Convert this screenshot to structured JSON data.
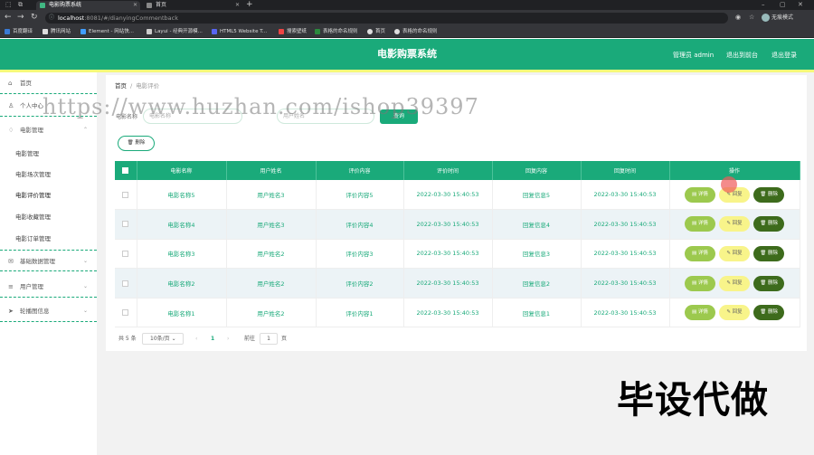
{
  "browser": {
    "tabs": [
      {
        "label": "电影购票系统",
        "active": true
      },
      {
        "label": "首页",
        "active": false
      }
    ],
    "url_host": "localhost",
    "url_path": ":8081/#/dianyingCommentback",
    "profile_label": "无痕模式",
    "bookmarks": [
      "百度翻译",
      "腾讯网站",
      "Element - 网站快...",
      "Layui - 经典开源模...",
      "HTML5 Website T...",
      "搜索壁纸",
      "表格的命名规则",
      "首页",
      "表格的命名规则"
    ]
  },
  "app": {
    "title": "电影购票系统",
    "user_label": "管理员 admin",
    "back_link": "退出到前台",
    "logout_link": "退出登录"
  },
  "sidebar": {
    "items": [
      {
        "label": "首页",
        "icon": "home-icon",
        "type": "top"
      },
      {
        "label": "个人中心",
        "icon": "user-icon",
        "type": "group"
      },
      {
        "label": "电影管理",
        "icon": "bulb-icon",
        "type": "group-open"
      },
      {
        "label": "电影管理",
        "type": "sub"
      },
      {
        "label": "电影场次管理",
        "type": "sub"
      },
      {
        "label": "电影评价管理",
        "type": "sub-active"
      },
      {
        "label": "电影收藏管理",
        "type": "sub"
      },
      {
        "label": "电影订单管理",
        "type": "sub"
      },
      {
        "label": "基础数据管理",
        "icon": "mail-icon",
        "type": "group"
      },
      {
        "label": "用户管理",
        "icon": "menu-icon",
        "type": "group"
      },
      {
        "label": "轮播图信息",
        "icon": "send-icon",
        "type": "group"
      }
    ]
  },
  "breadcrumb": {
    "home": "首页",
    "sep": "/",
    "current": "电影评价"
  },
  "search": {
    "label": "电影名称",
    "name_placeholder": "电影名称",
    "user_placeholder": "用户姓名",
    "button": "查询"
  },
  "batch_delete": "删除",
  "table": {
    "headers": [
      "电影名称",
      "用户姓名",
      "评价内容",
      "评价时间",
      "回复内容",
      "回复时间",
      "操作"
    ],
    "rows": [
      {
        "movie": "电影名称5",
        "user": "用户姓名3",
        "comment": "评价内容5",
        "comment_time": "2022-03-30 15:40:53",
        "reply": "回复信息5",
        "reply_time": "2022-03-30 15:40:53"
      },
      {
        "movie": "电影名称4",
        "user": "用户姓名3",
        "comment": "评价内容4",
        "comment_time": "2022-03-30 15:40:53",
        "reply": "回复信息4",
        "reply_time": "2022-03-30 15:40:53"
      },
      {
        "movie": "电影名称3",
        "user": "用户姓名2",
        "comment": "评价内容3",
        "comment_time": "2022-03-30 15:40:53",
        "reply": "回复信息3",
        "reply_time": "2022-03-30 15:40:53"
      },
      {
        "movie": "电影名称2",
        "user": "用户姓名2",
        "comment": "评价内容2",
        "comment_time": "2022-03-30 15:40:53",
        "reply": "回复信息2",
        "reply_time": "2022-03-30 15:40:53"
      },
      {
        "movie": "电影名称1",
        "user": "用户姓名2",
        "comment": "评价内容1",
        "comment_time": "2022-03-30 15:40:53",
        "reply": "回复信息1",
        "reply_time": "2022-03-30 15:40:53"
      }
    ],
    "actions": {
      "detail": "详情",
      "reply": "回复",
      "delete": "删除"
    }
  },
  "pagination": {
    "total": "共 5 条",
    "page_size": "10条/页",
    "prev": "‹",
    "current_page": "1",
    "next": "›",
    "goto_label": "前往",
    "goto_value": "1",
    "page_suffix": "页"
  },
  "overlay": {
    "watermark": "https://www.huzhan.com/ishop39397",
    "promo": "毕设代做"
  },
  "colors": {
    "primary": "#1aaa7a",
    "detail": "#9cc94e",
    "reply": "#f8f48a",
    "delete": "#3d6b1c"
  }
}
